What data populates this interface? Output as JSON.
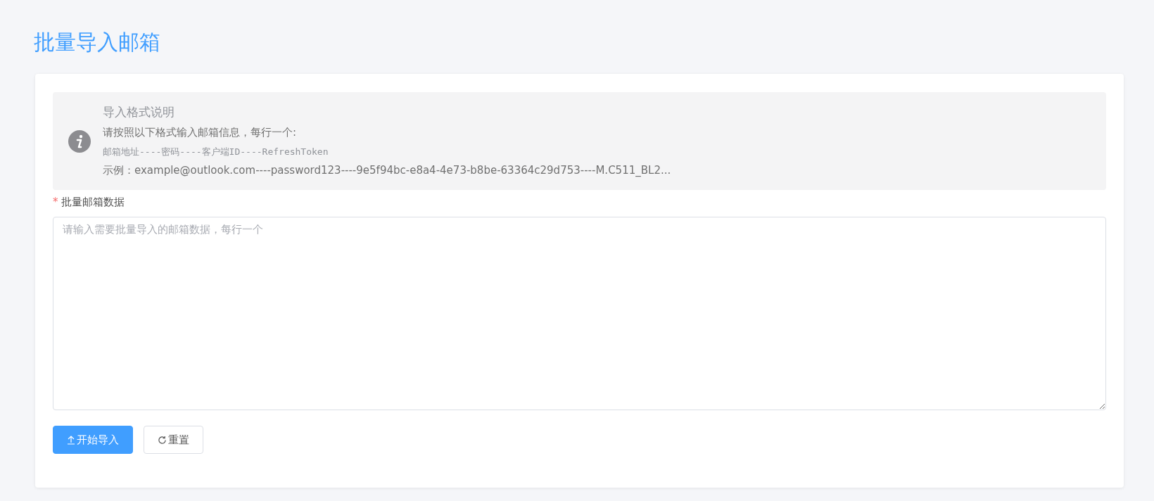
{
  "page_title": "批量导入邮箱",
  "notice": {
    "title": "导入格式说明",
    "lines": [
      {
        "kind": "text",
        "text": "请按照以下格式输入邮箱信息，每行一个:"
      },
      {
        "kind": "code",
        "text": "邮箱地址----密码----客户端ID----RefreshToken"
      },
      {
        "kind": "text",
        "text": "示例：example@outlook.com----password123----9e5f94bc-e8a4-4e73-b8be-63364c29d753----M.C511_BL2..."
      }
    ]
  },
  "field": {
    "required_mark": "*",
    "label": "批量邮箱数据",
    "placeholder": "请输入需要批量导入的邮箱数据，每行一个"
  },
  "buttons": [
    {
      "kind": "primary",
      "label": "开始导入"
    },
    {
      "kind": "default",
      "label": "重置"
    }
  ]
}
